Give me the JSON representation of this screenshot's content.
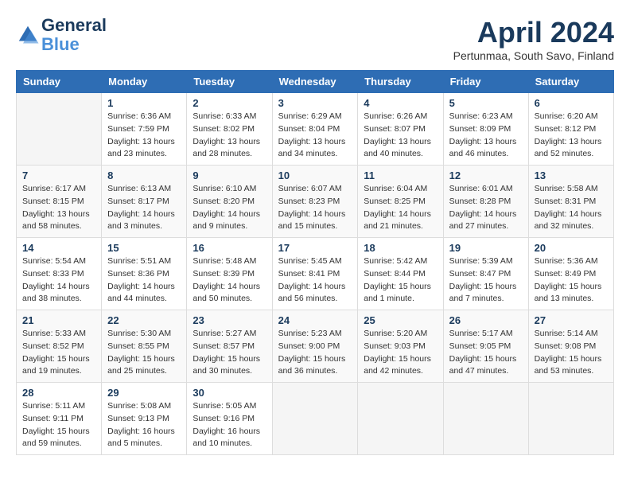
{
  "logo": {
    "line1": "General",
    "line2": "Blue"
  },
  "title": "April 2024",
  "subtitle": "Pertunmaa, South Savo, Finland",
  "days_of_week": [
    "Sunday",
    "Monday",
    "Tuesday",
    "Wednesday",
    "Thursday",
    "Friday",
    "Saturday"
  ],
  "weeks": [
    [
      {
        "day": "",
        "info": ""
      },
      {
        "day": "1",
        "info": "Sunrise: 6:36 AM\nSunset: 7:59 PM\nDaylight: 13 hours\nand 23 minutes."
      },
      {
        "day": "2",
        "info": "Sunrise: 6:33 AM\nSunset: 8:02 PM\nDaylight: 13 hours\nand 28 minutes."
      },
      {
        "day": "3",
        "info": "Sunrise: 6:29 AM\nSunset: 8:04 PM\nDaylight: 13 hours\nand 34 minutes."
      },
      {
        "day": "4",
        "info": "Sunrise: 6:26 AM\nSunset: 8:07 PM\nDaylight: 13 hours\nand 40 minutes."
      },
      {
        "day": "5",
        "info": "Sunrise: 6:23 AM\nSunset: 8:09 PM\nDaylight: 13 hours\nand 46 minutes."
      },
      {
        "day": "6",
        "info": "Sunrise: 6:20 AM\nSunset: 8:12 PM\nDaylight: 13 hours\nand 52 minutes."
      }
    ],
    [
      {
        "day": "7",
        "info": "Sunrise: 6:17 AM\nSunset: 8:15 PM\nDaylight: 13 hours\nand 58 minutes."
      },
      {
        "day": "8",
        "info": "Sunrise: 6:13 AM\nSunset: 8:17 PM\nDaylight: 14 hours\nand 3 minutes."
      },
      {
        "day": "9",
        "info": "Sunrise: 6:10 AM\nSunset: 8:20 PM\nDaylight: 14 hours\nand 9 minutes."
      },
      {
        "day": "10",
        "info": "Sunrise: 6:07 AM\nSunset: 8:23 PM\nDaylight: 14 hours\nand 15 minutes."
      },
      {
        "day": "11",
        "info": "Sunrise: 6:04 AM\nSunset: 8:25 PM\nDaylight: 14 hours\nand 21 minutes."
      },
      {
        "day": "12",
        "info": "Sunrise: 6:01 AM\nSunset: 8:28 PM\nDaylight: 14 hours\nand 27 minutes."
      },
      {
        "day": "13",
        "info": "Sunrise: 5:58 AM\nSunset: 8:31 PM\nDaylight: 14 hours\nand 32 minutes."
      }
    ],
    [
      {
        "day": "14",
        "info": "Sunrise: 5:54 AM\nSunset: 8:33 PM\nDaylight: 14 hours\nand 38 minutes."
      },
      {
        "day": "15",
        "info": "Sunrise: 5:51 AM\nSunset: 8:36 PM\nDaylight: 14 hours\nand 44 minutes."
      },
      {
        "day": "16",
        "info": "Sunrise: 5:48 AM\nSunset: 8:39 PM\nDaylight: 14 hours\nand 50 minutes."
      },
      {
        "day": "17",
        "info": "Sunrise: 5:45 AM\nSunset: 8:41 PM\nDaylight: 14 hours\nand 56 minutes."
      },
      {
        "day": "18",
        "info": "Sunrise: 5:42 AM\nSunset: 8:44 PM\nDaylight: 15 hours\nand 1 minute."
      },
      {
        "day": "19",
        "info": "Sunrise: 5:39 AM\nSunset: 8:47 PM\nDaylight: 15 hours\nand 7 minutes."
      },
      {
        "day": "20",
        "info": "Sunrise: 5:36 AM\nSunset: 8:49 PM\nDaylight: 15 hours\nand 13 minutes."
      }
    ],
    [
      {
        "day": "21",
        "info": "Sunrise: 5:33 AM\nSunset: 8:52 PM\nDaylight: 15 hours\nand 19 minutes."
      },
      {
        "day": "22",
        "info": "Sunrise: 5:30 AM\nSunset: 8:55 PM\nDaylight: 15 hours\nand 25 minutes."
      },
      {
        "day": "23",
        "info": "Sunrise: 5:27 AM\nSunset: 8:57 PM\nDaylight: 15 hours\nand 30 minutes."
      },
      {
        "day": "24",
        "info": "Sunrise: 5:23 AM\nSunset: 9:00 PM\nDaylight: 15 hours\nand 36 minutes."
      },
      {
        "day": "25",
        "info": "Sunrise: 5:20 AM\nSunset: 9:03 PM\nDaylight: 15 hours\nand 42 minutes."
      },
      {
        "day": "26",
        "info": "Sunrise: 5:17 AM\nSunset: 9:05 PM\nDaylight: 15 hours\nand 47 minutes."
      },
      {
        "day": "27",
        "info": "Sunrise: 5:14 AM\nSunset: 9:08 PM\nDaylight: 15 hours\nand 53 minutes."
      }
    ],
    [
      {
        "day": "28",
        "info": "Sunrise: 5:11 AM\nSunset: 9:11 PM\nDaylight: 15 hours\nand 59 minutes."
      },
      {
        "day": "29",
        "info": "Sunrise: 5:08 AM\nSunset: 9:13 PM\nDaylight: 16 hours\nand 5 minutes."
      },
      {
        "day": "30",
        "info": "Sunrise: 5:05 AM\nSunset: 9:16 PM\nDaylight: 16 hours\nand 10 minutes."
      },
      {
        "day": "",
        "info": ""
      },
      {
        "day": "",
        "info": ""
      },
      {
        "day": "",
        "info": ""
      },
      {
        "day": "",
        "info": ""
      }
    ]
  ]
}
